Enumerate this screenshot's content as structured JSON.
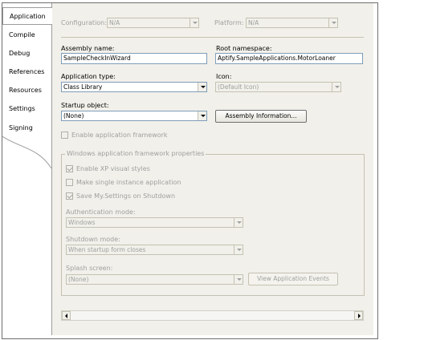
{
  "tabs": [
    {
      "label": "Application",
      "active": true
    },
    {
      "label": "Compile"
    },
    {
      "label": "Debug"
    },
    {
      "label": "References"
    },
    {
      "label": "Resources"
    },
    {
      "label": "Settings"
    },
    {
      "label": "Signing"
    }
  ],
  "configuration": {
    "label": "Configuration:",
    "value": "N/A"
  },
  "platform": {
    "label": "Platform:",
    "value": "N/A"
  },
  "assembly_name": {
    "label": "Assembly name:",
    "value": "SampleCheckInWizard"
  },
  "root_namespace": {
    "label": "Root namespace:",
    "value": "Aptify.SampleApplications.MotorLoaner"
  },
  "application_type": {
    "label": "Application type:",
    "value": "Class Library"
  },
  "icon": {
    "label": "Icon:",
    "value": "(Default Icon)"
  },
  "startup_object": {
    "label": "Startup object:",
    "value": "(None)"
  },
  "assembly_information_button": "Assembly Information...",
  "enable_framework": {
    "label": "Enable application framework",
    "checked": false
  },
  "framework_group": {
    "title": "Windows application framework properties",
    "enable_xp_styles": {
      "label": "Enable XP visual styles",
      "checked": true
    },
    "single_instance": {
      "label": "Make single instance application",
      "checked": false
    },
    "save_settings": {
      "label": "Save My.Settings on Shutdown",
      "checked": true
    },
    "authentication_mode": {
      "label": "Authentication mode:",
      "value": "Windows"
    },
    "shutdown_mode": {
      "label": "Shutdown mode:",
      "value": "When startup form closes"
    },
    "splash_screen": {
      "label": "Splash screen:",
      "value": "(None)"
    },
    "view_events_button": "View Application Events"
  }
}
